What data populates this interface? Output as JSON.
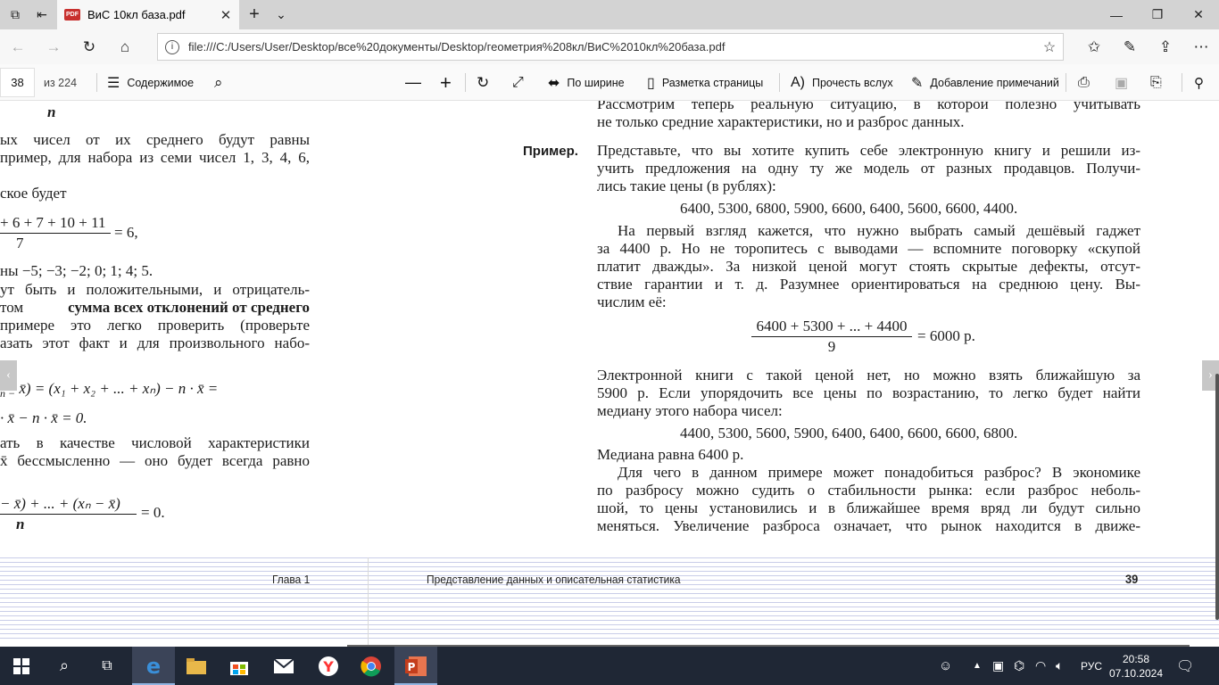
{
  "tab": {
    "badge": "PDF",
    "title": "ВиС 10кл база.pdf"
  },
  "address": {
    "url": "file:///C:/Users/User/Desktop/все%20документы/Desktop/геометрия%208кл/ВиС%2010кл%20база.pdf"
  },
  "pdf_toolbar": {
    "page": "38",
    "of": "из 224",
    "contents": "Содержимое",
    "fit_width": "По ширине",
    "page_layout": "Разметка страницы",
    "read_aloud": "Прочесть вслух",
    "add_notes": "Добавление примечаний"
  },
  "left_page": {
    "frac1_den": "n",
    "l1": "ых чисел от их среднего будут равны",
    "l2": "пример, для набора из семи чисел 1, 3, 4, 6,",
    "l3": "ское будет",
    "f2_num": "+ 6 + 7 + 10 + 11",
    "f2_den": "7",
    "f2_rhs": "= 6,",
    "l4": "ны −5; −3; −2; 0; 1; 4; 5.",
    "l5": "ут быть и положительными, и отрицатель-",
    "l6a": "том ",
    "l6b": "сумма всех отклонений от среднего",
    "l7": "примере это легко проверить (проверьте",
    "l8": "азать этот факт и для произвольного набо-",
    "eq1": "x̄) = (x₁ + x₂ + ... + xₙ) − n · x̄ =",
    "eq1_pre": "n −",
    "eq2": "· x̄ − n · x̄ = 0.",
    "l9": "ать в качестве числовой характеристики",
    "l10": "x̄ бессмысленно — оно будет всегда равно",
    "f3_num": "− x̄) + ... + (xₙ − x̄)",
    "f3_den": "n",
    "f3_rhs": "= 0."
  },
  "right_page": {
    "r1": "Рассмотрим теперь реальную ситуацию, в которой полезно учитывать",
    "r2": "не только средние характеристики, но и разброс данных.",
    "label_example": "Пример.",
    "p1": "Представьте, что вы хотите купить себе электронную книгу и решили из-",
    "p2": "учить предложения на одну ту же модель от разных продавцов. Получи-",
    "p3": "лись такие цены (в рублях):",
    "prices": "6400, 5300, 6800, 5900, 6600, 6400, 5600, 6600, 4400.",
    "q1": "На первый взгляд кажется, что нужно выбрать самый дешёвый гаджет",
    "q2": "за 4400 р. Но не торопитесь с выводами — вспомните поговорку «скупой",
    "q3": "платит дважды». За низкой ценой могут стоять скрытые дефекты, отсут-",
    "q4": "ствие гарантии и т. д. Разумнее ориентироваться на среднюю цену. Вы-",
    "q5": "числим её:",
    "fr_num": "6400 + 5300 + ... + 4400",
    "fr_den": "9",
    "fr_rhs": "= 6000 р.",
    "s1": "Электронной книги с такой ценой нет, но можно взять ближайшую за",
    "s2": "5900 р. Если упорядочить все цены по возрастанию, то легко будет найти",
    "s3": "медиану этого набора чисел:",
    "sorted": "4400, 5300, 5600, 5900, 6400, 6400, 6600, 6600, 6800.",
    "median": "Медиана равна 6400 р.",
    "t1": "Для чего в данном примере может понадобиться разброс? В экономике",
    "t2": "по разбросу можно судить о стабильности рынка: если разброс неболь-",
    "t3": "шой, то цены установились и в ближайшее время вряд ли будут сильно",
    "t4": "меняться. Увеличение разброса означает, что рынок находится в движе-"
  },
  "footer": {
    "chapter": "Глава 1",
    "section": "Представление данных и описательная статистика",
    "page_no": "39"
  },
  "taskbar": {
    "lang": "РУС",
    "time": "20:58",
    "date": "07.10.2024"
  }
}
